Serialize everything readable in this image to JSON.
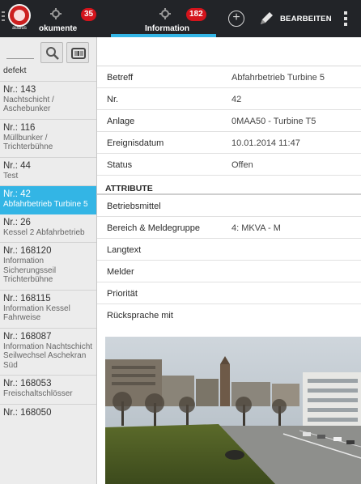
{
  "topbar": {
    "brand": "audius",
    "tab_left": {
      "label": "okumente",
      "badge": "35"
    },
    "tab_active": {
      "label": "Information",
      "badge": "182"
    },
    "edit_label": "BEARBEITEN",
    "icons": [
      "drawer-icon",
      "gear-icon",
      "add-icon",
      "pencil-icon",
      "overflow-icon"
    ]
  },
  "sidebar": {
    "search_placeholder": "",
    "items": [
      {
        "num": "",
        "sub": "defekt"
      },
      {
        "num": "Nr.: 143",
        "sub": "Nachtschicht / Aschebunker"
      },
      {
        "num": "Nr.: 116",
        "sub": "Müllbunker / Trichterbühne"
      },
      {
        "num": "Nr.: 44",
        "sub": "Test"
      },
      {
        "num": "Nr.: 42",
        "sub": "Abfahrbetrieb Turbine 5"
      },
      {
        "num": "Nr.: 26",
        "sub": "Kessel 2 Abfahrbetrieb"
      },
      {
        "num": "Nr.: 168120",
        "sub": "Information Sicherungsseil Trichterbühne"
      },
      {
        "num": "Nr.: 168115",
        "sub": "Information Kessel Fahrweise"
      },
      {
        "num": "Nr.: 168087",
        "sub": "Information Nachtschicht Seilwechsel Aschekran Süd"
      },
      {
        "num": "Nr.: 168053",
        "sub": "Freischaltschlösser"
      },
      {
        "num": "Nr.: 168050",
        "sub": ""
      }
    ]
  },
  "details": {
    "fields": [
      {
        "label": "Betreff",
        "value": "Abfahrbetrieb Turbine 5"
      },
      {
        "label": "Nr.",
        "value": "42"
      },
      {
        "label": "Anlage",
        "value": "0MAA50 - Turbine T5"
      },
      {
        "label": "Ereignisdatum",
        "value": "10.01.2014 11:47"
      },
      {
        "label": "Status",
        "value": "Offen"
      }
    ],
    "section_title": "ATTRIBUTE",
    "attributes": [
      {
        "label": "Betriebsmittel",
        "value": ""
      },
      {
        "label": "Bereich & Meldegruppe",
        "value": "4: MKVA - M"
      },
      {
        "label": "Langtext",
        "value": ""
      },
      {
        "label": "Melder",
        "value": ""
      },
      {
        "label": "Priorität",
        "value": ""
      },
      {
        "label": "Rücksprache mit",
        "value": ""
      }
    ]
  },
  "colors": {
    "accent": "#33b5e5",
    "topbar": "#222428",
    "badge": "#d4141c"
  }
}
